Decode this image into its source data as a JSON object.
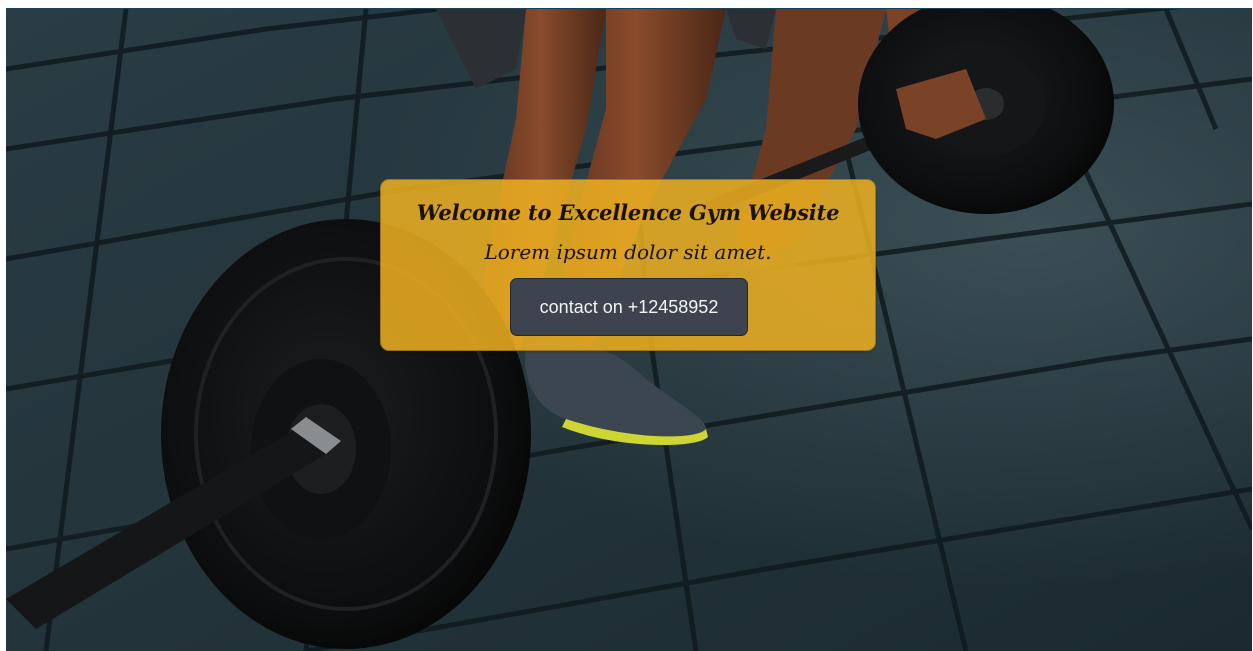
{
  "hero": {
    "background_image": "gym-barbell-deadlift-photo",
    "colors": {
      "card": "#EDB021",
      "button": "#3D4450",
      "button_text": "#F4F4F4",
      "heading_text": "#1A1206"
    }
  },
  "card": {
    "heading": "Welcome to Excellence Gym Website",
    "subtitle": "Lorem ipsum dolor sit amet.",
    "contact_button_label": "contact on +12458952"
  }
}
